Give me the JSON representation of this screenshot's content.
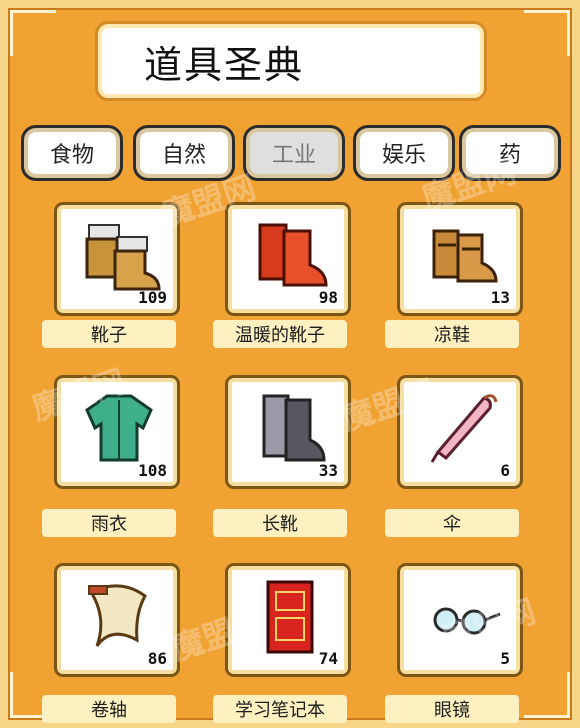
{
  "title": "道具圣典",
  "tabs": [
    {
      "label": "食物",
      "active": false
    },
    {
      "label": "自然",
      "active": false
    },
    {
      "label": "工业",
      "active": true
    },
    {
      "label": "娱乐",
      "active": false
    },
    {
      "label": "药",
      "active": false
    }
  ],
  "items": [
    {
      "name": "靴子",
      "count": "109",
      "icon": "boots-icon"
    },
    {
      "name": "温暖的靴子",
      "count": "98",
      "icon": "warm-boots-icon"
    },
    {
      "name": "凉鞋",
      "count": "13",
      "icon": "sandals-icon"
    },
    {
      "name": "雨衣",
      "count": "108",
      "icon": "raincoat-icon"
    },
    {
      "name": "长靴",
      "count": "33",
      "icon": "tall-boots-icon"
    },
    {
      "name": "伞",
      "count": "6",
      "icon": "umbrella-icon"
    },
    {
      "name": "卷轴",
      "count": "86",
      "icon": "scroll-icon"
    },
    {
      "name": "学习笔记本",
      "count": "74",
      "icon": "notebook-icon"
    },
    {
      "name": "眼镜",
      "count": "5",
      "icon": "glasses-icon"
    }
  ],
  "watermark": "魔盟网",
  "colors": {
    "background": "#f0a233",
    "label_bg": "#fdf0c1",
    "slot_border": "#7c5615"
  }
}
